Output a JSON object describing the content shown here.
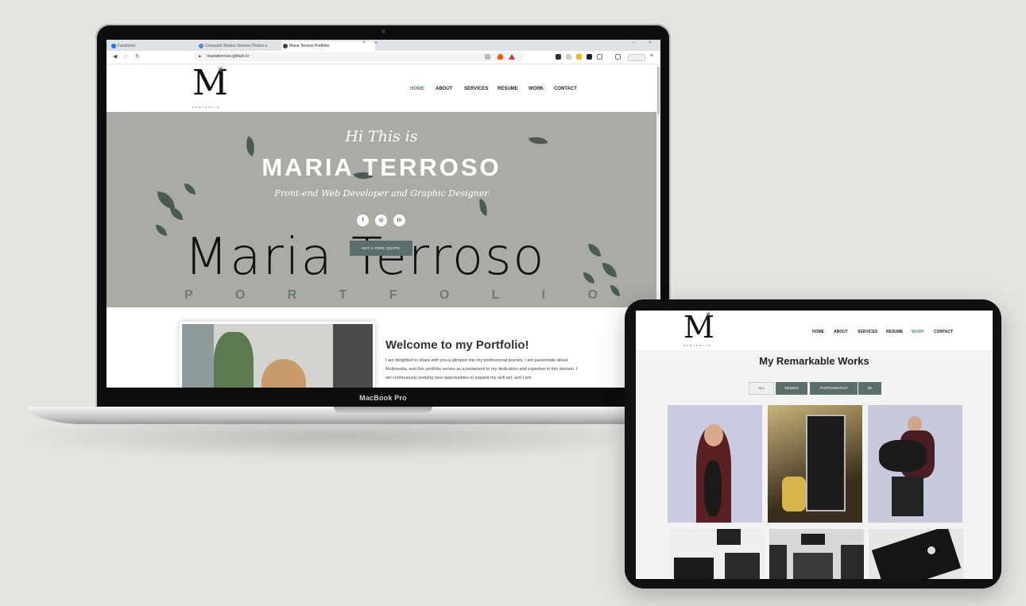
{
  "browser": {
    "tabs": [
      {
        "label": "Facebook"
      },
      {
        "label": "Computer Modes Venture Photos a"
      },
      {
        "label": "Maria Terroso Portfolio",
        "active": true
      }
    ],
    "url": "mariaterroso.github.io"
  },
  "site": {
    "logo_letter": "M",
    "logo_sub": "PORTFOLIO",
    "nav": [
      "HOME",
      "ABOUT",
      "SERVICES",
      "RESUME",
      "WORK",
      "CONTACT"
    ],
    "active_nav": "HOME",
    "hero": {
      "greeting": "Hi This is",
      "name": "MARIA TERROSO",
      "role": "Front-end Web Developer and Graphic Designer",
      "script_name": "Maria Terroso",
      "portfolio_word": [
        "P",
        "O",
        "R",
        "T",
        "F",
        "O",
        "L",
        "I",
        "O"
      ],
      "cta": "GET A FREE QUOTE",
      "social_icons": [
        "facebook-icon",
        "instagram-icon",
        "linkedin-icon"
      ]
    },
    "welcome": {
      "title": "Welcome to my Portfolio!",
      "text": "I am delighted to share with you a glimpse into my professional journey. I am passionate about Multimedia, and this portfolio serves as a testament to my dedication and expertise in this domain. I am continuously seeking new opportunities to expand my skill set, and I am"
    }
  },
  "device": {
    "laptop_label": "MacBook Pro"
  },
  "tablet": {
    "nav": [
      "HOME",
      "ABOUT",
      "SERVICES",
      "RESUME",
      "WORK",
      "CONTACT"
    ],
    "active_nav": "WORK",
    "section_title": "My Remarkable Works",
    "filters": [
      "ALL",
      "DESIGN",
      "PHOTOGRAPHY",
      "3D"
    ],
    "active_filter": "ALL"
  },
  "colors": {
    "accent": "#5b6e6c",
    "hero_bg": "#a9aba4",
    "leaf": "#4a5a55"
  }
}
